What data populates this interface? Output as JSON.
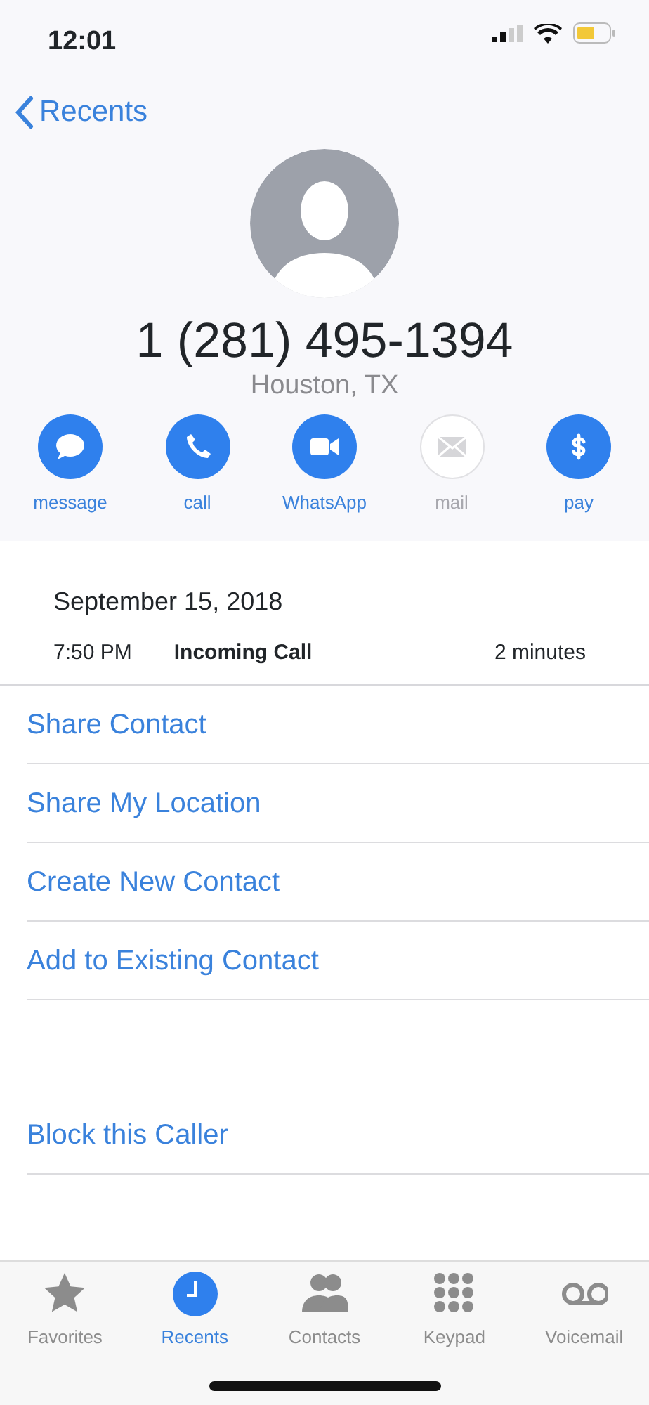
{
  "status_bar": {
    "time": "12:01"
  },
  "back": {
    "label": "Recents"
  },
  "contact": {
    "number": "1 (281) 495-1394",
    "location": "Houston, TX"
  },
  "actions": [
    {
      "kind": "message",
      "label": "message",
      "disabled": false
    },
    {
      "kind": "call",
      "label": "call",
      "disabled": false
    },
    {
      "kind": "video",
      "label": "WhatsApp",
      "disabled": false
    },
    {
      "kind": "mail",
      "label": "mail",
      "disabled": true
    },
    {
      "kind": "pay",
      "label": "pay",
      "disabled": false
    }
  ],
  "call_log": {
    "date": "September 15, 2018",
    "time": "7:50 PM",
    "type": "Incoming Call",
    "duration": "2 minutes"
  },
  "options": [
    {
      "label": "Share Contact"
    },
    {
      "label": "Share My Location"
    },
    {
      "label": "Create New Contact"
    },
    {
      "label": "Add to Existing Contact"
    }
  ],
  "block": {
    "label": "Block this Caller"
  },
  "tabs": [
    {
      "kind": "favorites",
      "label": "Favorites",
      "selected": false
    },
    {
      "kind": "recents",
      "label": "Recents",
      "selected": true
    },
    {
      "kind": "contacts",
      "label": "Contacts",
      "selected": false
    },
    {
      "kind": "keypad",
      "label": "Keypad",
      "selected": false
    },
    {
      "kind": "voicemail",
      "label": "Voicemail",
      "selected": false
    }
  ]
}
